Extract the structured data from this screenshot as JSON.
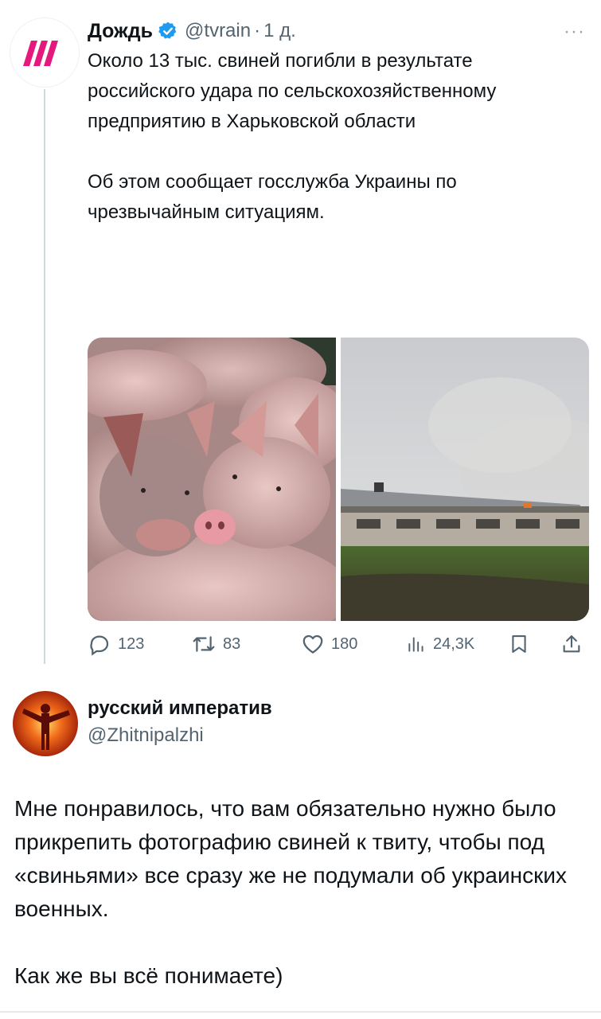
{
  "tweet": {
    "author": "Дождь",
    "handle": "@tvrain",
    "separator": "·",
    "time": "1 д.",
    "paragraphs": [
      "Около 13 тыс. свиней погибли в результате российского удара по сельскохозяйственному предприятию в Харьковской области",
      "Об этом сообщает госслужба Украины по чрезвычайным ситуациям."
    ],
    "stats": {
      "replies": "123",
      "retweets": "83",
      "likes": "180",
      "views": "24,3K"
    }
  },
  "reply": {
    "author": "русский императив",
    "handle": "@Zhitnipalzhi",
    "paragraphs": [
      "Мне понравилось, что вам обязательно нужно было прикрепить фотографию свиней к твиту, чтобы под «свиньями» все сразу же не подумали об украинских военных.",
      "Как же вы всё понимаете)"
    ]
  },
  "colors": {
    "text": "#0f1419",
    "secondary": "#536471",
    "verified": "#1d9bf0",
    "dozhd_brand": "#e5197d"
  }
}
